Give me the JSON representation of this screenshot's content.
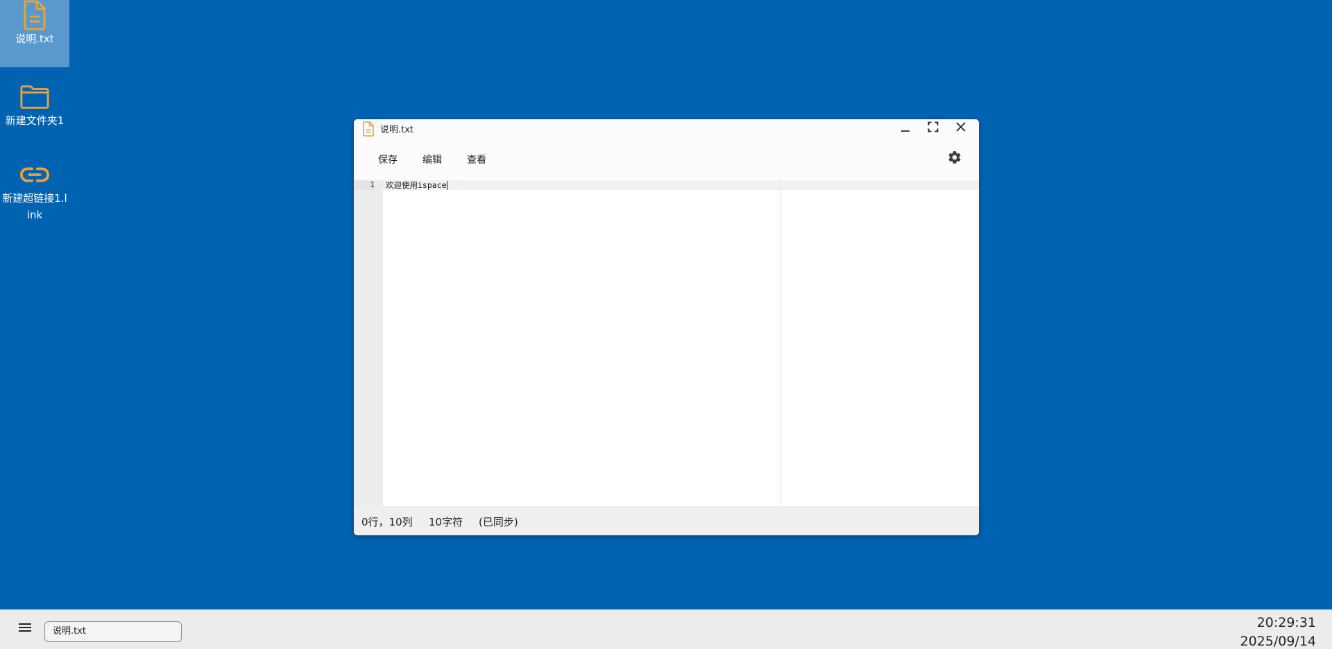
{
  "desktop": {
    "icons": [
      {
        "label": "说明.txt",
        "type": "file-icon"
      },
      {
        "label": "新建文件夹1",
        "type": "folder-icon"
      },
      {
        "label": "新建超链接1.link",
        "type": "link-icon"
      }
    ]
  },
  "window": {
    "title": "说明.txt",
    "icon": "file-icon",
    "controls": {
      "minimize": "minimize-icon",
      "maximize": "maximize-icon",
      "close": "close-icon"
    },
    "menu": {
      "save": "保存",
      "edit": "编辑",
      "view": "查看"
    },
    "settings_icon": "gear-icon",
    "editor": {
      "line_numbers": [
        "1"
      ],
      "lines": [
        "欢迎使用ispace"
      ]
    },
    "status": {
      "position": "0行，10列",
      "chars": "10字符",
      "sync": "(已同步)"
    }
  },
  "taskbar": {
    "menu_icon": "hamburger-icon",
    "items": [
      {
        "label": "说明.txt"
      }
    ],
    "time": "20:29:31",
    "date": "2025/09/14"
  },
  "colors": {
    "desktop_bg": "#0063b1",
    "icon_accent": "#f0a030",
    "taskbar_bg": "#ececec"
  }
}
